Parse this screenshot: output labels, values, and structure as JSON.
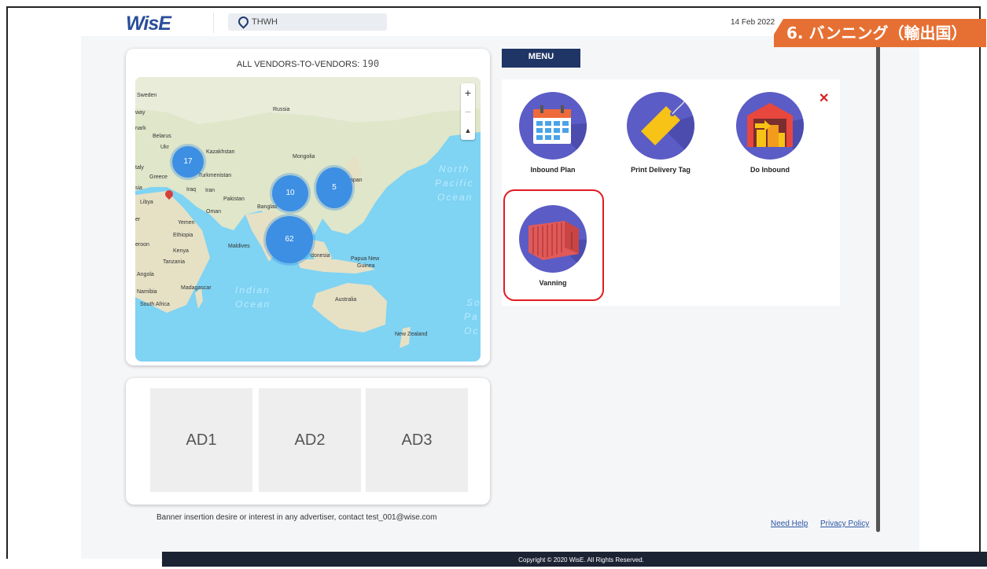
{
  "app": {
    "logo": "WisE",
    "location": "THWH",
    "date": "14 Feb 2022"
  },
  "banner": {
    "text": "6. バンニング（輸出国）"
  },
  "map_card": {
    "title": "ALL VENDORS-TO-VENDORS: ",
    "count": "190",
    "zoom_in": "+",
    "zoom_out": "−",
    "compass": "▲",
    "clusters": [
      "17",
      "10",
      "5",
      "62"
    ],
    "labels": {
      "sweden": "Sweden",
      "way": "way",
      "russia": "Russia",
      "nark": "nark",
      "belarus": "Belarus",
      "ukr": "Ukr",
      "kazakhstan": "Kazakhstan",
      "mongolia": "Mongolia",
      "italy": "taly",
      "greece": "Greece",
      "turkmenistan": "Turkmenistan",
      "sia": "sia",
      "iraq": "Iraq",
      "iran": "Iran",
      "japan": "apan",
      "libya": "Libya",
      "pakistan": "Pakistan",
      "bangladesh": "Banglad",
      "oman": "Oman",
      "er": "er",
      "yemen": "Yemen",
      "ethiopia": "Ethiopia",
      "eroon": "eroon",
      "maldives": "Maldives",
      "kenya": "Kenya",
      "tanzania": "Tanzania",
      "indonesia": "donesia",
      "png": "Papua New",
      "png2": "Guinea",
      "angola": "Angola",
      "namibia": "Namibia",
      "madagascar": "Madagascar",
      "south_africa": "South Africa",
      "australia": "Australia",
      "new_zealand": "New Zealand",
      "north": "North",
      "pacific": "Pacific",
      "ocean": "Ocean",
      "indian": "Indian",
      "indian_ocean": "Ocean",
      "so": "So",
      "pa": "Pa",
      "oc": "Oc"
    }
  },
  "ads": [
    "AD1",
    "AD2",
    "AD3"
  ],
  "advert_note": "Banner insertion desire or interest in any advertiser, contact  test_001@wise.com",
  "menu": {
    "tab": "MENU",
    "close": "✕",
    "items": [
      {
        "label": "Inbound Plan",
        "icon": "calendar-icon"
      },
      {
        "label": "Print Delivery Tag",
        "icon": "tag-icon"
      },
      {
        "label": "Do Inbound",
        "icon": "warehouse-icon"
      },
      {
        "label": "Vanning",
        "icon": "container-icon"
      }
    ]
  },
  "footer_links": {
    "help": "Need Help",
    "privacy": "Privacy Policy"
  },
  "copyright": "Copyright © 2020 WisE. All Rights Reserved."
}
